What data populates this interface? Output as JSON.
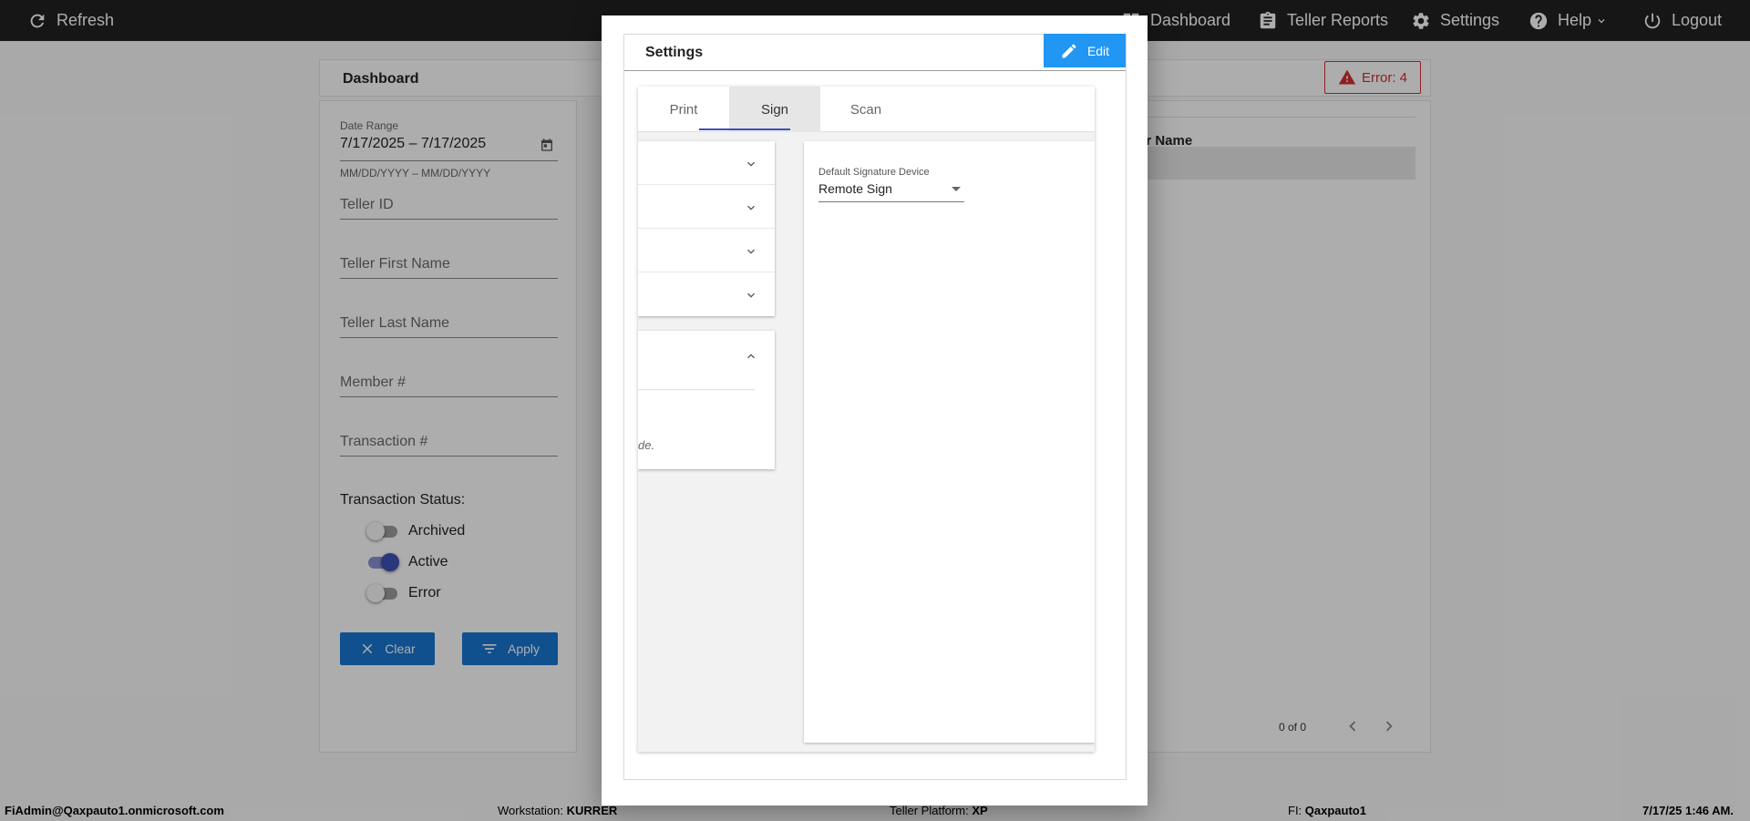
{
  "topbar": {
    "refresh_label": "Refresh",
    "nav": [
      {
        "label": "Dashboard",
        "icon": "dashboard-icon"
      },
      {
        "label": "Teller Reports",
        "icon": "clipboard-icon"
      },
      {
        "label": "Settings",
        "icon": "gear-icon"
      },
      {
        "label": "Help",
        "icon": "help-icon"
      },
      {
        "label": "Logout",
        "icon": "power-icon"
      }
    ]
  },
  "dashboard": {
    "title": "Dashboard",
    "error_badge": "Error: 4",
    "filters": {
      "date_range_label": "Date Range",
      "date_range_value": "7/17/2025 – 7/17/2025",
      "date_range_hint": "MM/DD/YYYY – MM/DD/YYYY",
      "teller_id": "Teller ID",
      "teller_first_name": "Teller First Name",
      "teller_last_name": "Teller Last Name",
      "member_no": "Member #",
      "transaction_no": "Transaction #",
      "status_title": "Transaction Status:",
      "statuses": [
        {
          "label": "Archived",
          "on": false
        },
        {
          "label": "Active",
          "on": true
        },
        {
          "label": "Error",
          "on": false
        }
      ],
      "clear_label": "Clear",
      "apply_label": "Apply"
    },
    "results": {
      "column_header": "er Name",
      "pagination": "0 of 0"
    }
  },
  "footer": {
    "user": "FiAdmin@Qaxpauto1.onmicrosoft.com",
    "workstation_label": "Workstation:",
    "workstation_value": "KURRER",
    "platform_label": "Teller Platform:",
    "platform_value": "XP",
    "fi_label": "FI:",
    "fi_value": "Qaxpauto1",
    "datetime": "7/17/25 1:46 AM."
  },
  "modal": {
    "title": "Settings",
    "edit_label": "Edit",
    "tabs": [
      {
        "label": "Print",
        "active": false
      },
      {
        "label": "Sign",
        "active": true
      },
      {
        "label": "Scan",
        "active": false
      }
    ],
    "expanded_note": "de.",
    "signature": {
      "label": "Default Signature Device",
      "value": "Remote Sign"
    }
  },
  "colors": {
    "primary_button": "#1976d2",
    "edit_button": "#2196f3",
    "error": "#d32f2f",
    "toggle_active": "#3f51b5",
    "topbar": "#212121"
  }
}
